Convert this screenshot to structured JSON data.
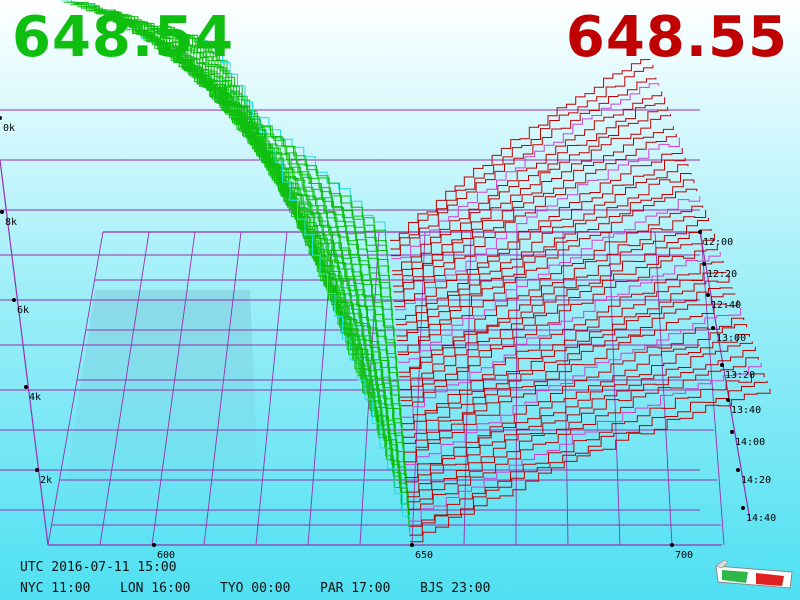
{
  "prices": {
    "bid": "648.54",
    "ask": "648.55",
    "bid_color": "#0fbf0f",
    "ask_color": "#c00000"
  },
  "clock": {
    "utc": "UTC 2016-07-11 15:00",
    "zones": [
      {
        "label": "NYC 11:00"
      },
      {
        "label": "LON 16:00"
      },
      {
        "label": "TYO 00:00"
      },
      {
        "label": "PAR 17:00"
      },
      {
        "label": "BJS 23:00"
      }
    ]
  },
  "chart_data": {
    "type": "area",
    "description_free": true,
    "x_ticks": [
      "600",
      "650",
      "700"
    ],
    "x_range": [
      572,
      722
    ],
    "y_ticks": [
      "2k",
      "4k",
      "6k",
      "8k",
      "0k"
    ],
    "time_ticks": [
      "12:00",
      "12:20",
      "12:40",
      "13:00",
      "13:20",
      "13:40",
      "14:00",
      "14:20",
      "14:40"
    ],
    "series": [
      {
        "side": "bid",
        "color": "#0fbf0f",
        "edge_color": "#22dddd"
      },
      {
        "side": "ask",
        "color": "#c00000",
        "edge_color": "#d040d0"
      }
    ],
    "grid": true,
    "grid_color": "#9a2fb0",
    "mid_price": 650
  },
  "icons": {
    "glasses": "3d-glasses-icon"
  }
}
